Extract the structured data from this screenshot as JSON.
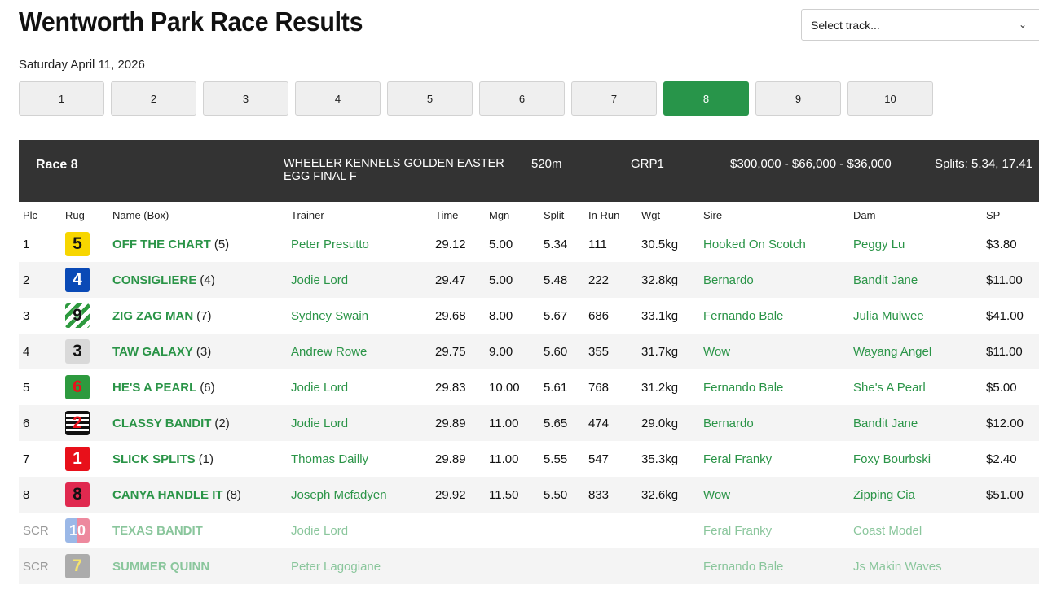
{
  "page": {
    "title": "Wentworth Park Race Results",
    "date": "Saturday April 11, 2026",
    "track_select_placeholder": "Select track...",
    "active_race": "8"
  },
  "race_tabs": [
    "1",
    "2",
    "3",
    "4",
    "5",
    "6",
    "7",
    "8",
    "9",
    "10"
  ],
  "race_header": {
    "race": "Race 8",
    "name": "WHEELER KENNELS GOLDEN EASTER EGG FINAL F",
    "distance": "520m",
    "grade": "GRP1",
    "prize": "$300,000 - $66,000 - $36,000",
    "splits": "Splits: 5.34, 17.41"
  },
  "columns": [
    "Plc",
    "Rug",
    "Name (Box)",
    "Trainer",
    "Time",
    "Mgn",
    "Split",
    "In Run",
    "Wgt",
    "Sire",
    "Dam",
    "SP"
  ],
  "runners": [
    {
      "plc": "1",
      "rug": "5",
      "name": "OFF THE CHART",
      "box": "(5)",
      "trainer": "Peter Presutto",
      "time": "29.12",
      "mgn": "5.00",
      "split": "5.34",
      "inrun": "111",
      "wgt": "30.5kg",
      "sire": "Hooked On Scotch",
      "dam": "Peggy Lu",
      "sp": "$3.80"
    },
    {
      "plc": "2",
      "rug": "4",
      "name": "CONSIGLIERE",
      "box": "(4)",
      "trainer": "Jodie Lord",
      "time": "29.47",
      "mgn": "5.00",
      "split": "5.48",
      "inrun": "222",
      "wgt": "32.8kg",
      "sire": "Bernardo",
      "dam": "Bandit Jane",
      "sp": "$11.00"
    },
    {
      "plc": "3",
      "rug": "9",
      "name": "ZIG ZAG MAN",
      "box": "(7)",
      "trainer": "Sydney Swain",
      "time": "29.68",
      "mgn": "8.00",
      "split": "5.67",
      "inrun": "686",
      "wgt": "33.1kg",
      "sire": "Fernando Bale",
      "dam": "Julia Mulwee",
      "sp": "$41.00"
    },
    {
      "plc": "4",
      "rug": "3",
      "name": "TAW GALAXY",
      "box": "(3)",
      "trainer": "Andrew Rowe",
      "time": "29.75",
      "mgn": "9.00",
      "split": "5.60",
      "inrun": "355",
      "wgt": "31.7kg",
      "sire": "Wow",
      "dam": "Wayang Angel",
      "sp": "$11.00"
    },
    {
      "plc": "5",
      "rug": "6",
      "name": "HE'S A PEARL",
      "box": "(6)",
      "trainer": "Jodie Lord",
      "time": "29.83",
      "mgn": "10.00",
      "split": "5.61",
      "inrun": "768",
      "wgt": "31.2kg",
      "sire": "Fernando Bale",
      "dam": "She's A Pearl",
      "sp": "$5.00"
    },
    {
      "plc": "6",
      "rug": "2",
      "name": "CLASSY BANDIT",
      "box": "(2)",
      "trainer": "Jodie Lord",
      "time": "29.89",
      "mgn": "11.00",
      "split": "5.65",
      "inrun": "474",
      "wgt": "29.0kg",
      "sire": "Bernardo",
      "dam": "Bandit Jane",
      "sp": "$12.00"
    },
    {
      "plc": "7",
      "rug": "1",
      "name": "SLICK SPLITS",
      "box": "(1)",
      "trainer": "Thomas Dailly",
      "time": "29.89",
      "mgn": "11.00",
      "split": "5.55",
      "inrun": "547",
      "wgt": "35.3kg",
      "sire": "Feral Franky",
      "dam": "Foxy Bourbski",
      "sp": "$2.40"
    },
    {
      "plc": "8",
      "rug": "8",
      "name": "CANYA HANDLE IT",
      "box": "(8)",
      "trainer": "Joseph Mcfadyen",
      "time": "29.92",
      "mgn": "11.50",
      "split": "5.50",
      "inrun": "833",
      "wgt": "32.6kg",
      "sire": "Wow",
      "dam": "Zipping Cia",
      "sp": "$51.00"
    },
    {
      "plc": "SCR",
      "rug": "10",
      "name": "TEXAS BANDIT",
      "box": "",
      "trainer": "Jodie Lord",
      "time": "",
      "mgn": "",
      "split": "",
      "inrun": "",
      "wgt": "",
      "sire": "Feral Franky",
      "dam": "Coast Model",
      "sp": ""
    },
    {
      "plc": "SCR",
      "rug": "7",
      "name": "SUMMER QUINN",
      "box": "",
      "trainer": "Peter Lagogiane",
      "time": "",
      "mgn": "",
      "split": "",
      "inrun": "",
      "wgt": "",
      "sire": "Fernando Bale",
      "dam": "Js Makin Waves",
      "sp": ""
    }
  ]
}
